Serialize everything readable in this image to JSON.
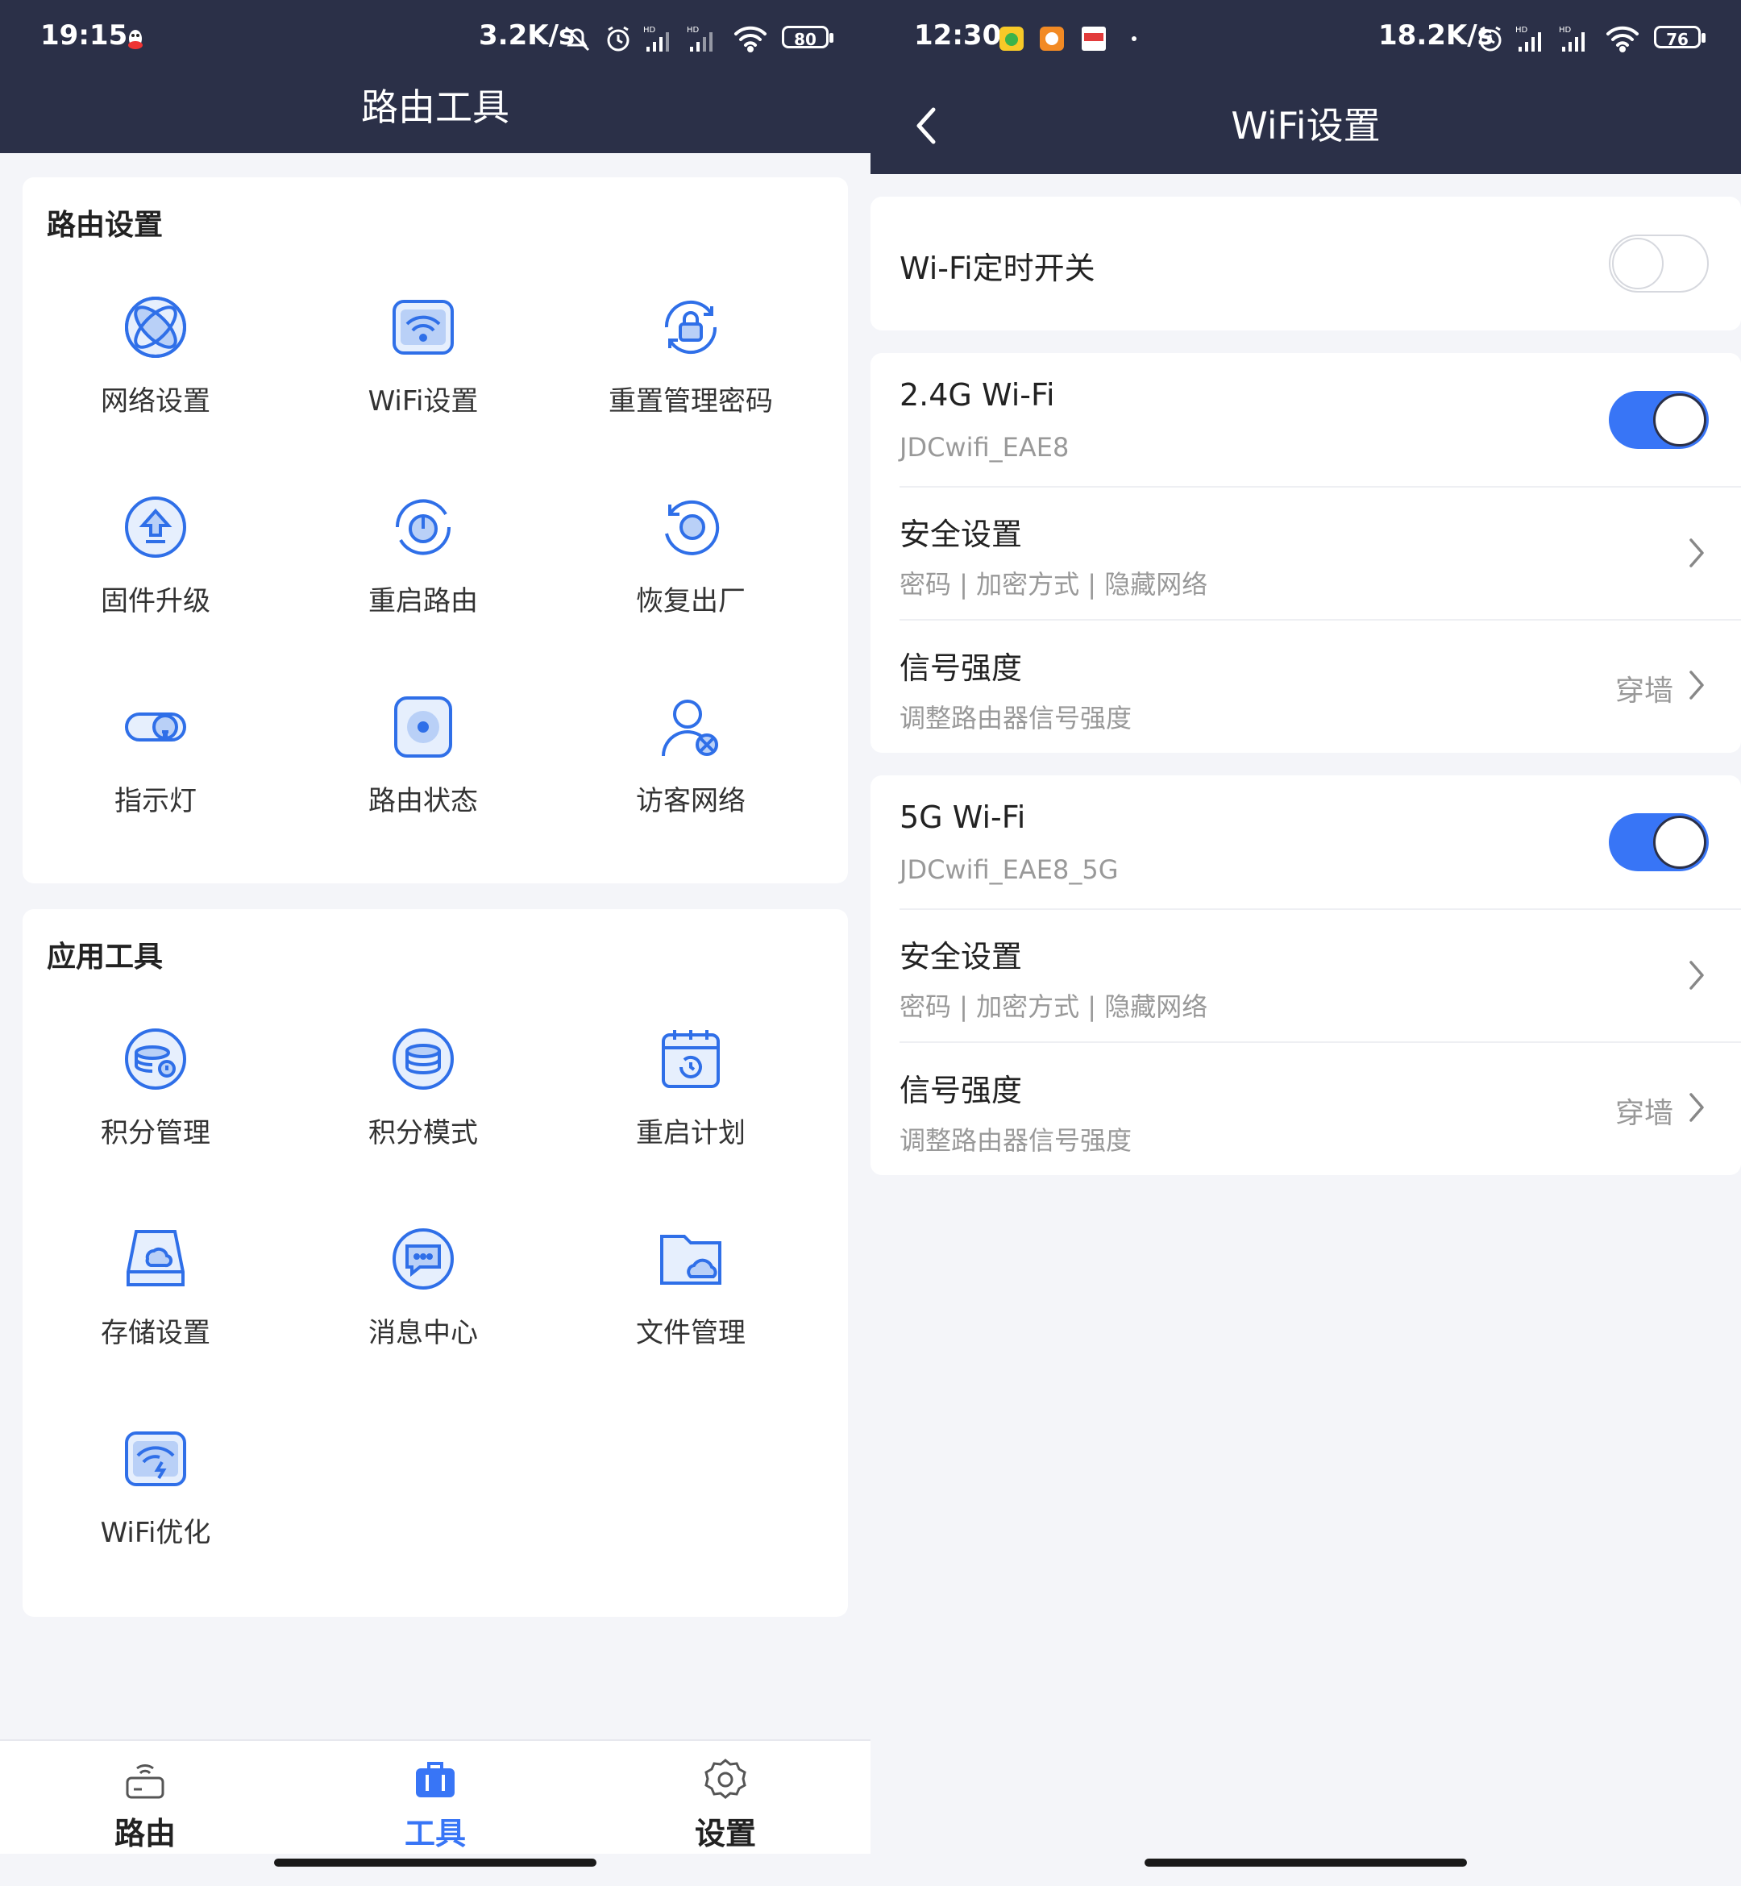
{
  "left": {
    "status": {
      "time": "19:15",
      "speed": "3.2K/s",
      "battery": "80"
    },
    "title": "路由工具",
    "router_settings": {
      "title": "路由设置",
      "items": [
        {
          "label": "网络设置",
          "icon": "globe-icon"
        },
        {
          "label": "WiFi设置",
          "icon": "wifi-icon"
        },
        {
          "label": "重置管理密码",
          "icon": "lock-reset-icon"
        },
        {
          "label": "固件升级",
          "icon": "upgrade-icon"
        },
        {
          "label": "重启路由",
          "icon": "power-restart-icon"
        },
        {
          "label": "恢复出厂",
          "icon": "factory-reset-icon"
        },
        {
          "label": "指示灯",
          "icon": "light-toggle-icon"
        },
        {
          "label": "路由状态",
          "icon": "router-status-icon"
        },
        {
          "label": "访客网络",
          "icon": "guest-network-icon"
        }
      ]
    },
    "app_tools": {
      "title": "应用工具",
      "items": [
        {
          "label": "积分管理",
          "icon": "points-manage-icon"
        },
        {
          "label": "积分模式",
          "icon": "points-mode-icon"
        },
        {
          "label": "重启计划",
          "icon": "reboot-schedule-icon"
        },
        {
          "label": "存储设置",
          "icon": "storage-icon"
        },
        {
          "label": "消息中心",
          "icon": "message-icon"
        },
        {
          "label": "文件管理",
          "icon": "file-folder-icon"
        },
        {
          "label": "WiFi优化",
          "icon": "wifi-optimize-icon"
        }
      ]
    },
    "tabs": [
      {
        "label": "路由",
        "icon": "router-icon",
        "active": false
      },
      {
        "label": "工具",
        "icon": "toolbox-icon",
        "active": true
      },
      {
        "label": "设置",
        "icon": "gear-icon",
        "active": false
      }
    ]
  },
  "right": {
    "status": {
      "time": "12:30",
      "speed": "18.2K/s",
      "battery": "76"
    },
    "title": "WiFi设置",
    "timer": {
      "label": "Wi-Fi定时开关",
      "on": false
    },
    "band_24": {
      "title": "2.4G Wi-Fi",
      "ssid": "JDCwifi_EAE8",
      "on": true,
      "security_title": "安全设置",
      "security_sub": "密码 | 加密方式 | 隐藏网络",
      "signal_title": "信号强度",
      "signal_sub": "调整路由器信号强度",
      "signal_value": "穿墙"
    },
    "band_5": {
      "title": "5G Wi-Fi",
      "ssid": "JDCwifi_EAE8_5G",
      "on": true,
      "security_title": "安全设置",
      "security_sub": "密码 | 加密方式 | 隐藏网络",
      "signal_title": "信号强度",
      "signal_sub": "调整路由器信号强度",
      "signal_value": "穿墙"
    }
  },
  "colors": {
    "accent": "#3875f6",
    "header": "#2b3048",
    "icon_blue": "#2f6fe8"
  }
}
